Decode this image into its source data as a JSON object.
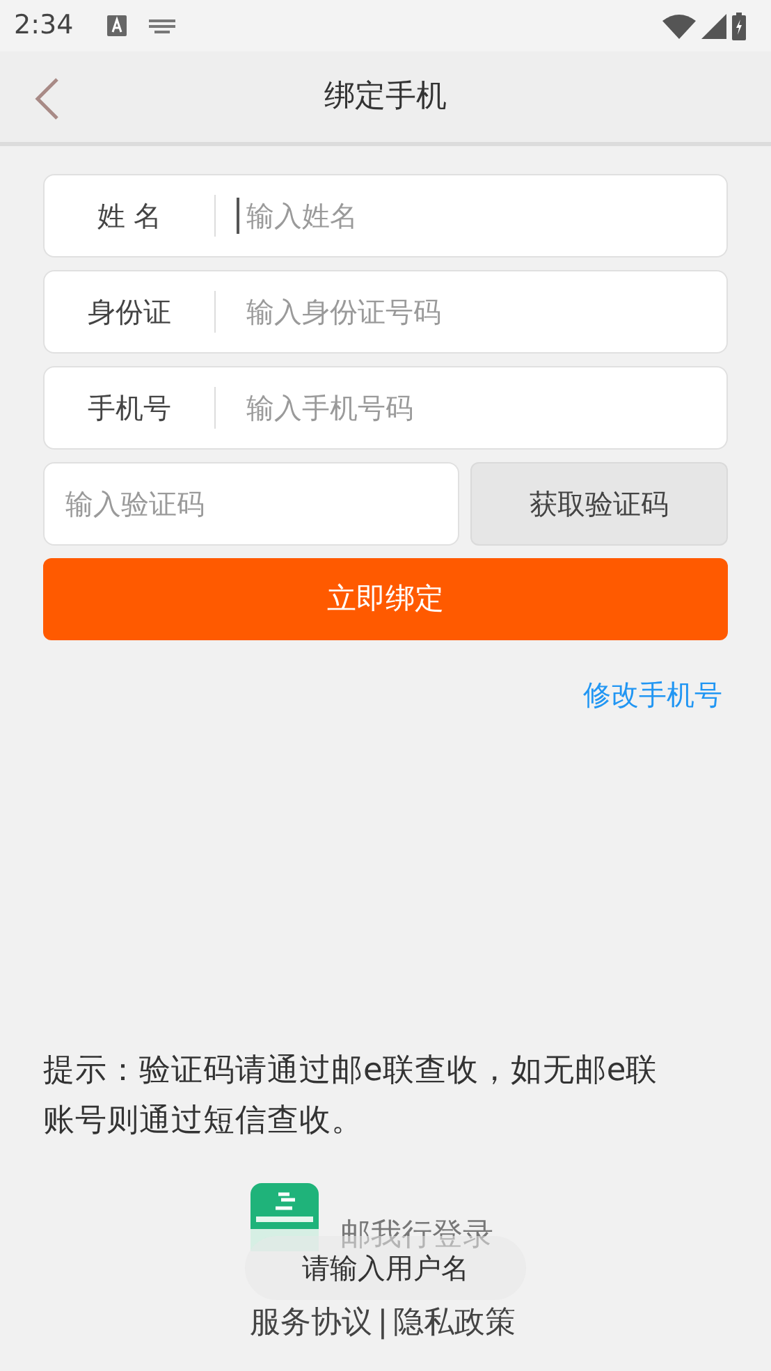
{
  "status_bar": {
    "time": "2:34"
  },
  "header": {
    "title": "绑定手机"
  },
  "fields": [
    {
      "label": "姓 名",
      "placeholder": "输入姓名",
      "focused": true
    },
    {
      "label": "身份证",
      "placeholder": "输入身份证号码",
      "focused": false
    },
    {
      "label": "手机号",
      "placeholder": "输入手机号码",
      "focused": false
    }
  ],
  "code": {
    "placeholder": "输入验证码",
    "button": "获取验证码"
  },
  "submit": "立即绑定",
  "change_phone_link": "修改手机号",
  "hint": "提示：验证码请通过邮e联查收，如无邮e联账号则通过短信查收。",
  "brand": {
    "title": "邮我行登录"
  },
  "toast": "请输入用户名",
  "footer": {
    "links": [
      "服务协议",
      "隐私政策"
    ],
    "separator": "|"
  }
}
